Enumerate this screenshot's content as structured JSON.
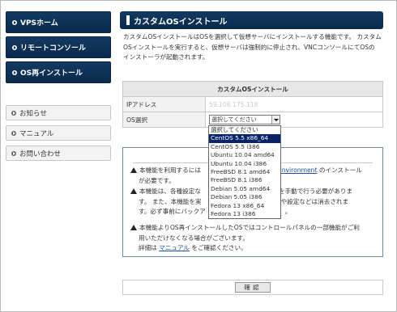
{
  "sidebar": {
    "primary": [
      {
        "label": "VPSホーム"
      },
      {
        "label": "リモートコンソール"
      },
      {
        "label": "OS再インストール"
      }
    ],
    "secondary": [
      {
        "label": "お知らせ"
      },
      {
        "label": "マニュアル"
      },
      {
        "label": "お問い合わせ"
      }
    ]
  },
  "header": {
    "title": "カスタムOSインストール"
  },
  "description": [
    "カスタムOSインストールはOSを選択して仮想サーバにインストールする機能です。 カスタム",
    "OSインストールを実行すると、仮想サーバは強制的に停止され、VNCコンソールにてOSの",
    "インストーラが起動されます。"
  ],
  "form": {
    "section_title": "カスタムOSインストール",
    "ip_label": "IPアドレス",
    "ip_value": "59.106.175.118",
    "os_label": "OS選択",
    "os_selected": "選択してください"
  },
  "dropdown": {
    "options": [
      "選択してください",
      "CentOS 5.5 x86_64",
      "CentOS 5.5 i386",
      "Ubuntu 10.04 amd64",
      "Ubuntu 10.04 i386",
      "FreeBSD 8.1 amd64",
      "FreeBSD 8.1 i386",
      "Debian 5.05 amd64",
      "Debian 5.05 i386",
      "Fedora 13 x86_64",
      "Fedora 13 i386"
    ],
    "highlighted_index": 1
  },
  "notice": {
    "item1_a": "本機能を利用するには",
    "item1_link": "Environment",
    "item1_b": " のインストール",
    "item1_line2": "が必要です。",
    "item2_line1": "本機能は、各種設定な",
    "item2_line1_b": "を手動で行う必要がありま",
    "item2_line2": "す。 また、本機能を実",
    "item2_line2_b": "や設定などは消去されま",
    "item2_line3": "す。必ず事前にバックア",
    "item2_line3_b": "。",
    "item3_line1": "本機能よりOS再インストールしたOSではコントロールパネルの一部機能がご利",
    "item3_line2": "用いただけなくなる場合がございます。",
    "item3_line3_a": "詳細は ",
    "item3_link": "マニュアル",
    "item3_line3_b": " をご確認ください。"
  },
  "confirm": {
    "label": "確認"
  }
}
